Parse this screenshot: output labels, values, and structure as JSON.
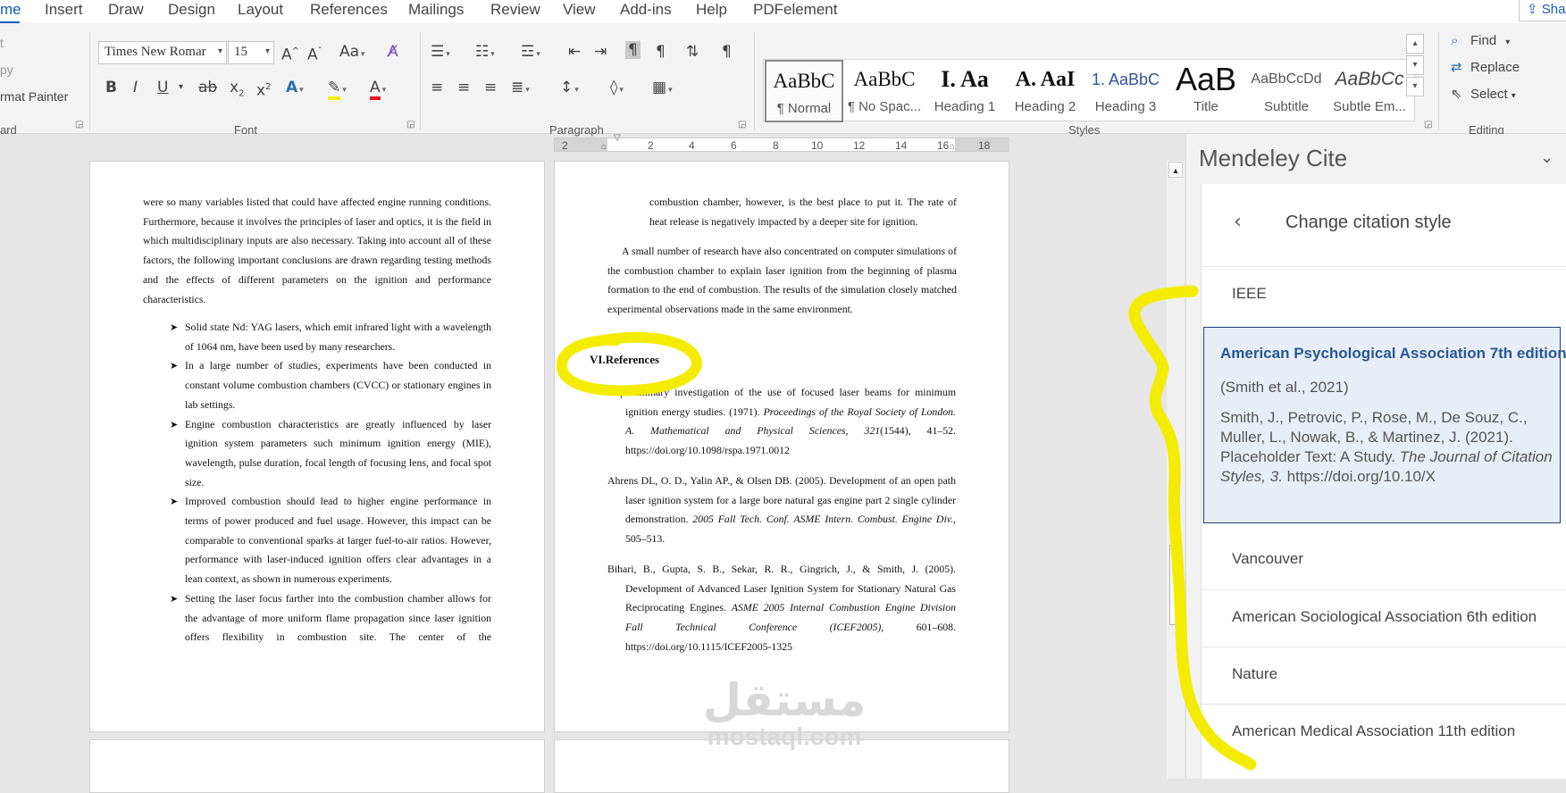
{
  "menu": {
    "tabs": [
      "me",
      "Insert",
      "Draw",
      "Design",
      "Layout",
      "References",
      "Mailings",
      "Review",
      "View",
      "Add-ins",
      "Help",
      "PDFelement"
    ],
    "share_label": "Sha"
  },
  "ribbon": {
    "clipboard": {
      "cut": "t",
      "copy": "py",
      "format_painter": "rmat Painter",
      "group_label": "ard"
    },
    "font": {
      "font_name": "Times New Romar",
      "font_size": "15",
      "grow_label": "A",
      "shrink_label": "A",
      "case_label": "Aa",
      "bold": "B",
      "italic": "I",
      "underline": "U",
      "strike": "ab",
      "subscript": "x",
      "superscript": "x",
      "group_label": "Font"
    },
    "paragraph": {
      "group_label": "Paragraph"
    },
    "styles": {
      "items": [
        {
          "preview": "AaBbC",
          "label": "¶ Normal"
        },
        {
          "preview": "AaBbC",
          "label": "¶ No Spac..."
        },
        {
          "preview": "I. Aa",
          "label": "Heading 1"
        },
        {
          "preview": "A. AaI",
          "label": "Heading 2"
        },
        {
          "preview": "1. AaBbC",
          "label": "Heading 3"
        },
        {
          "preview": "AaB",
          "label": "Title"
        },
        {
          "preview": "AaBbCcDd",
          "label": "Subtitle"
        },
        {
          "preview": "AaBbCc",
          "label": "Subtle Em..."
        }
      ],
      "group_label": "Styles"
    },
    "editing": {
      "find": "Find",
      "replace": "Replace",
      "select": "Select",
      "group_label": "Editing"
    }
  },
  "ruler": {
    "ticks": [
      "2",
      "2",
      "4",
      "6",
      "8",
      "10",
      "12",
      "14",
      "16",
      "18"
    ]
  },
  "doc": {
    "left_page": {
      "intro": "were so many variables listed that could have affected engine running conditions. Furthermore, because it involves the principles of laser and optics, it is the field in which multidisciplinary inputs are also necessary. Taking into account all of these factors, the following important conclusions are drawn regarding testing methods and the effects of different parameters on the ignition and performance characteristics.",
      "bullets": [
        "Solid state Nd: YAG lasers, which emit infrared light with a wavelength of 1064 nm, have been used by many researchers.",
        "In a large number of studies, experiments have been conducted in constant volume combustion chambers (CVCC) or stationary engines in lab settings.",
        "Engine combustion characteristics are greatly influenced by laser ignition system parameters such minimum ignition energy (MIE), wavelength, pulse duration, focal length of focusing lens, and focal spot size.",
        "Improved combustion should lead to higher engine performance in terms of power produced and fuel usage. However, this impact can be comparable to conventional sparks at larger fuel-to-air ratios. However, performance with laser-induced ignition offers clear advantages in a lean context, as shown in numerous experiments.",
        "Setting the laser focus farther into the combustion chamber allows for the advantage of more uniform flame propagation since laser ignition offers flexibility in combustion site. The center of the"
      ]
    },
    "right_page": {
      "continuation": "combustion chamber, however, is the best place to put it. The rate of heat release is negatively impacted by a deeper site for ignition.",
      "paragraph": "A small number of research have also concentrated on computer simulations of the combustion chamber to explain laser ignition from the beginning of plasma formation to the end of combustion. The results of the simulation closely matched experimental observations made in the same environment.",
      "heading": "VI.References",
      "references": [
        {
          "pre": "A preliminary investigation of the use of focused laser beams for minimum ignition energy studies. (1971). ",
          "it": "Proceedings of the Royal Society of London. A. Mathematical and Physical Sciences, 321",
          "post": "(1544), 41–52. https://doi.org/10.1098/rspa.1971.0012"
        },
        {
          "pre": "Ahrens DL, O. D., Yalin AP., & Olsen DB. (2005). Development of an open path laser ignition system for a large bore natural gas engine part 2 single cylinder demonstration. ",
          "it": "2005 Fall Tech. Conf. ASME Intern. Combust. Engine Div.",
          "post": ", 505–513."
        },
        {
          "pre": "Bihari, B., Gupta, S. B., Sekar, R. R., Gingrich, J., & Smith, J. (2005). Development of Advanced Laser Ignition System for Stationary Natural Gas Reciprocating Engines. ",
          "it": "ASME 2005 Internal Combustion Engine Division Fall Technical Conference (ICEF2005)",
          "post": ", 601–608. https://doi.org/10.1115/ICEF2005-1325"
        }
      ]
    },
    "watermark_arabic": "مستقل",
    "watermark_latin": "mostaql.com"
  },
  "pane": {
    "title": "Mendeley Cite",
    "subtitle": "Change citation style",
    "styles_before": [
      "IEEE"
    ],
    "selected": {
      "name": "American Psychological Association 7th edition",
      "inline": "(Smith et al., 2021)",
      "full_pre": "Smith, J., Petrovic, P., Rose, M., De Souz, C., Muller, L., Nowak, B., & Martinez, J. (2021). Placeholder Text: A Study. ",
      "full_it": "The Journal of Citation Styles, 3.",
      "full_post": " https://doi.org/10.10/X"
    },
    "styles_after": [
      "Vancouver",
      "American Sociological Association 6th edition",
      "Nature",
      "American Medical Association 11th edition"
    ]
  },
  "colors": {
    "accent": "#185abd",
    "highlight": "#f4ec00",
    "apa_title": "#2a5696",
    "apa_bg": "#e8eef7"
  }
}
